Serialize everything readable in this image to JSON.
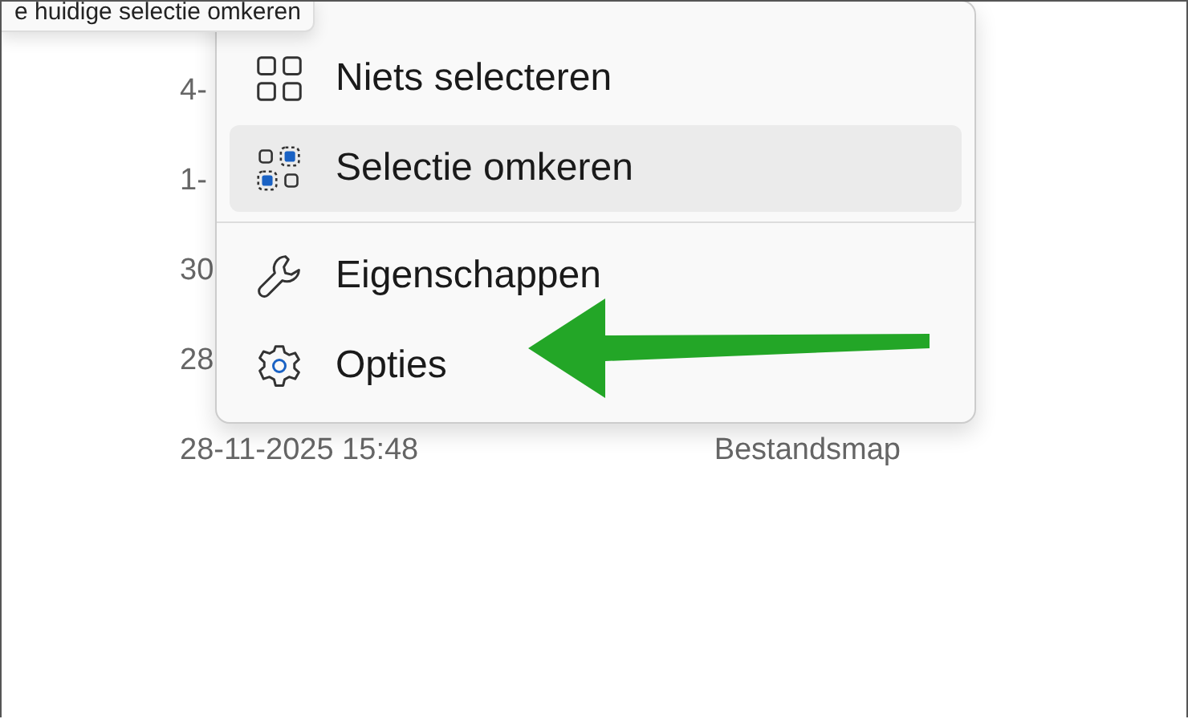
{
  "tooltip": {
    "text": "e huidige selectie omkeren"
  },
  "file_rows": [
    {
      "date": "4-"
    },
    {
      "date": "1-"
    },
    {
      "date": "30"
    },
    {
      "date": "28"
    },
    {
      "date": "28-11-2025 15:48",
      "type": "Bestandsmap"
    }
  ],
  "context_menu": {
    "groups": [
      {
        "items": [
          {
            "kind": "select-none",
            "label": "Niets selecteren",
            "selected": false
          },
          {
            "kind": "invert",
            "label": "Selectie omkeren",
            "selected": true
          }
        ]
      },
      {
        "items": [
          {
            "kind": "properties",
            "label": "Eigenschappen",
            "selected": false
          },
          {
            "kind": "options",
            "label": "Opties",
            "selected": false
          }
        ]
      }
    ]
  }
}
